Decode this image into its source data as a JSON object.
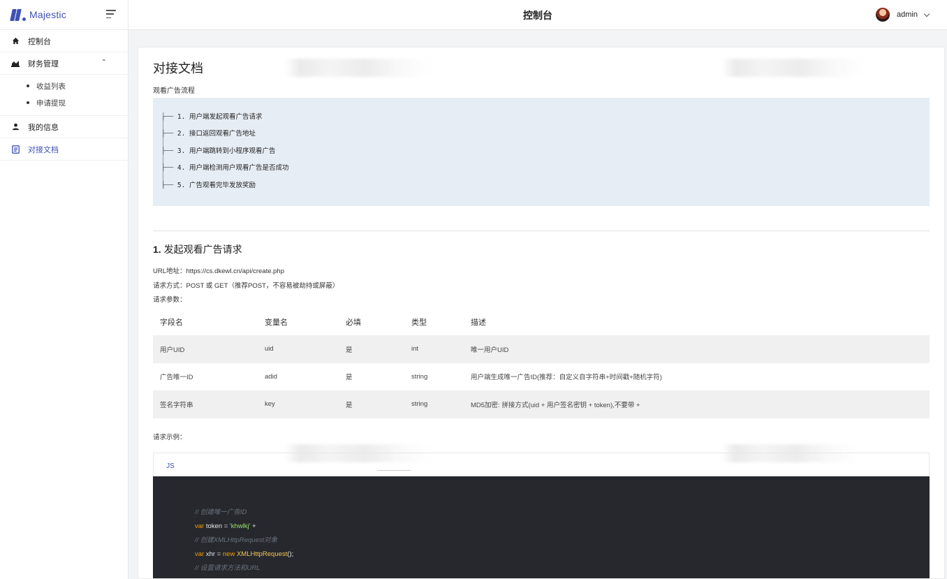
{
  "brand": {
    "name": "Majestic"
  },
  "sidebar": {
    "items": [
      {
        "label": "控制台",
        "icon": "home-icon"
      },
      {
        "label": "财务管理",
        "icon": "finance-icon"
      },
      {
        "label": "我的信息",
        "icon": "user-icon"
      },
      {
        "label": "对接文档",
        "icon": "document-icon"
      }
    ],
    "finance_sub": [
      {
        "label": "收益列表"
      },
      {
        "label": "申请提现"
      }
    ]
  },
  "header": {
    "title": "控制台",
    "username": "admin"
  },
  "doc": {
    "title": "对接文档",
    "flow_label": "观看广告流程",
    "flow_steps": [
      "1. 用户端发起观看广告请求",
      "2. 接口返回观看广告地址",
      "3. 用户端跳转到小程序观看广告",
      "4. 用户端检测用户观看广告是否成功",
      "5. 广告观看完毕发放奖励"
    ],
    "section1": {
      "number": "1.",
      "title": "发起观看广告请求",
      "url_label": "URL地址：",
      "url": "https://cs.dkewl.cn/api/create.php",
      "method_label": "请求方式：",
      "method": "POST 或 GET（推荐POST，不容易被劫持或屏蔽）",
      "params_label": "请求参数："
    },
    "table": {
      "headers": [
        "字段名",
        "变量名",
        "必填",
        "类型",
        "描述"
      ],
      "rows": [
        [
          "用户UID",
          "uid",
          "是",
          "int",
          "唯一用户UID"
        ],
        [
          "广告唯一ID",
          "adid",
          "是",
          "string",
          "用户端生成唯一广告ID(推荐：自定义自字符串+时间戳+随机字符)"
        ],
        [
          "签名字符串",
          "key",
          "是",
          "string",
          "MD5加密: 拼接方式(uid + 用户签名密钥 + token),不要带 +"
        ]
      ]
    },
    "example_label": "请求示例：",
    "tab_label": "JS",
    "code": {
      "comment1": "// 创建唯一广告ID",
      "line2_kw": "var",
      "line2_text": " token = ",
      "line2_str": "'khwlkj'",
      "line2_tail": " +",
      "comment2": "// 创建XMLHttpRequest对象",
      "line4_kw": "var",
      "line4_text": " xhr = ",
      "line4_new": "new",
      "line4_cls": " XMLHttpRequest",
      "line4_tail": "();",
      "comment3": "// 设置请求方法和URL"
    }
  },
  "colors": {
    "accent": "#3f51b5",
    "flow_bg": "#e6edf5",
    "code_bg": "#26282d"
  }
}
